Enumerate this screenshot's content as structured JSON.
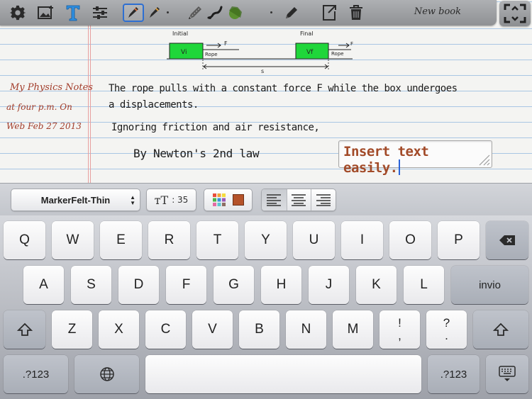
{
  "toolbar": {
    "book_title": "New book",
    "icons": [
      "gear-icon",
      "insert-image-icon",
      "text-tool-icon",
      "sliders-icon",
      "pen-black-icon",
      "pen-brown-icon",
      "pencil-icon",
      "brush-icon",
      "eraser-icon",
      "edit-pencil-icon",
      "export-icon",
      "trash-icon",
      "fullscreen-icon"
    ]
  },
  "notes": {
    "sidebar": {
      "title": "My  Physics Notes",
      "time": "at four p.m.  On",
      "date": "Web Feb 27 2013"
    },
    "diagram": {
      "initial_label": "Initial",
      "final_label": "Final",
      "box_initial_label": "Vi",
      "box_final_label": "Vf",
      "rope_label": "Rope",
      "force_label": "F",
      "displacement_label": "s",
      "box_color": "#1fd63a"
    },
    "lines": [
      "The rope pulls with a constant force F while the box undergoes",
      "a displacements.",
      "Ignoring friction and air resistance,",
      "By Newton's 2nd law"
    ],
    "text_box": {
      "value": "Insert text easily."
    }
  },
  "format_bar": {
    "font_name": "MarkerFelt-Thin",
    "font_size_label": ": 35",
    "text_color": "#b5532a",
    "palette_colors": [
      "#e94d3b",
      "#f1a33a",
      "#f4dc3d",
      "#4cb649",
      "#3a8fd9",
      "#9b59b6",
      "#e36aa3",
      "#5cc6d0",
      "#8d6e63"
    ],
    "alignments": [
      "align-left",
      "align-center",
      "align-right"
    ],
    "selected_alignment": "align-left"
  },
  "keyboard": {
    "row1": [
      "Q",
      "W",
      "E",
      "R",
      "T",
      "Y",
      "U",
      "I",
      "O",
      "P"
    ],
    "row2": [
      "A",
      "S",
      "D",
      "F",
      "G",
      "H",
      "J",
      "K",
      "L"
    ],
    "row3": [
      "Z",
      "X",
      "C",
      "V",
      "B",
      "N",
      "M"
    ],
    "punct1_top": "!",
    "punct1_bottom": ",",
    "punct2_top": "?",
    "punct2_bottom": ".",
    "return_label": "invio",
    "numbers_label_left": ".?123",
    "numbers_label_right": ".?123"
  }
}
